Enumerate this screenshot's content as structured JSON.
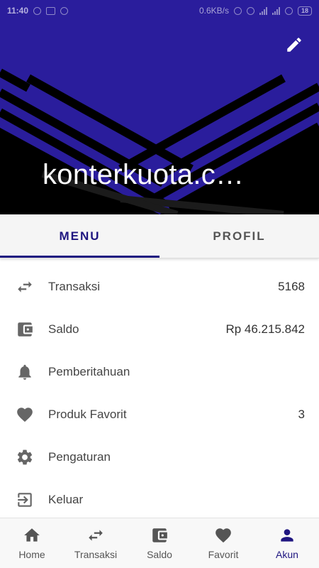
{
  "status_bar": {
    "time": "11:40",
    "network_speed": "0.6KB/s",
    "battery": "18"
  },
  "header": {
    "title": "konterkuota.c…",
    "edit_icon": "pencil-icon",
    "background_color": "#2a1d9c"
  },
  "tabs": [
    {
      "label": "MENU",
      "active": true
    },
    {
      "label": "PROFIL",
      "active": false
    }
  ],
  "menu": {
    "items": [
      {
        "label": "Transaksi",
        "value": "5168",
        "icon": "swap-arrows-icon"
      },
      {
        "label": "Saldo",
        "value": "Rp 46.215.842",
        "icon": "wallet-icon"
      },
      {
        "label": "Pemberitahuan",
        "value": "",
        "icon": "bell-icon"
      },
      {
        "label": "Produk Favorit",
        "value": "3",
        "icon": "heart-icon"
      },
      {
        "label": "Pengaturan",
        "value": "",
        "icon": "gear-icon"
      },
      {
        "label": "Keluar",
        "value": "",
        "icon": "logout-icon"
      }
    ]
  },
  "bottom_nav": {
    "items": [
      {
        "label": "Home",
        "icon": "home-icon",
        "active": false
      },
      {
        "label": "Transaksi",
        "icon": "swap-arrows-icon",
        "active": false
      },
      {
        "label": "Saldo",
        "icon": "wallet-icon",
        "active": false
      },
      {
        "label": "Favorit",
        "icon": "heart-icon",
        "active": false
      },
      {
        "label": "Akun",
        "icon": "person-icon",
        "active": true
      }
    ]
  },
  "colors": {
    "primary": "#1f1680",
    "icon_gray": "#666666"
  }
}
